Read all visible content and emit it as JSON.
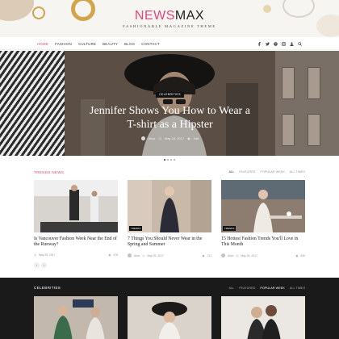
{
  "logo": {
    "news": "NEWS",
    "max": "MAX",
    "tagline": "FASHIONABLE MAGAZINE THEME"
  },
  "nav": {
    "items": [
      {
        "label": "HOME",
        "active": true
      },
      {
        "label": "FASHION",
        "active": false
      },
      {
        "label": "CULTURE",
        "active": false
      },
      {
        "label": "BEAUTY",
        "active": false
      },
      {
        "label": "BLOG",
        "active": false
      },
      {
        "label": "CONTACT",
        "active": false
      }
    ],
    "social_icons": [
      "facebook-icon",
      "twitter-icon",
      "pinterest-icon",
      "instagram-icon",
      "user-icon",
      "search-icon"
    ]
  },
  "slider": {
    "category": "CELEBRITIES",
    "title": "Jennifer Shows You How to Wear a T-shirt as a Hipster",
    "author": "Alice",
    "date": "May 25, 2017",
    "views": "946"
  },
  "trends": {
    "title": "TRENDS NEWS",
    "filters": [
      "ALL",
      "FEATURED",
      "POPULAR WEEK",
      "ALL TIMES"
    ],
    "cards": [
      {
        "category": "",
        "title": "Is Vancouver Fashion Week Near the End of the Runway?",
        "author": "",
        "date": "May 25, 2017",
        "views": "678"
      },
      {
        "category": "TRENDS",
        "title": "7 Things You Should Never Wear in the Spring and Summer",
        "author": "Alice",
        "date": "May 25, 2017",
        "views": "712"
      },
      {
        "category": "TRENDS",
        "title": "15 Hottest Fashion Trends You'll Love in This Month",
        "author": "Alice",
        "date": "May 25, 2017",
        "views": "836"
      }
    ],
    "pagination": [
      "‹",
      "›"
    ]
  },
  "celebrities": {
    "title": "CELEBRITIES",
    "filters": [
      "ALL",
      "FEATURED",
      "POPULAR WEEK",
      "ALL TIMES"
    ]
  },
  "colors": {
    "accent": "#e0457b",
    "dark": "#1a1a1a"
  }
}
